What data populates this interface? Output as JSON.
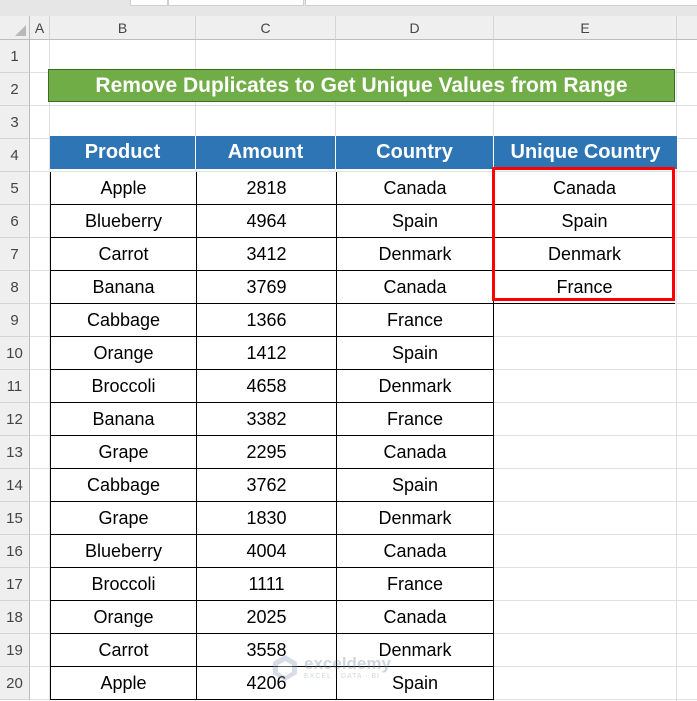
{
  "columns": [
    "A",
    "B",
    "C",
    "D",
    "E"
  ],
  "rows": [
    "1",
    "2",
    "3",
    "4",
    "5",
    "6",
    "7",
    "8",
    "9",
    "10",
    "11",
    "12",
    "13",
    "14",
    "15",
    "16",
    "17",
    "18",
    "19",
    "20"
  ],
  "title": "Remove Duplicates to Get Unique Values from Range",
  "headers": {
    "product": "Product",
    "amount": "Amount",
    "country": "Country",
    "unique_country": "Unique Country"
  },
  "table": [
    {
      "product": "Apple",
      "amount": "2818",
      "country": "Canada"
    },
    {
      "product": "Blueberry",
      "amount": "4964",
      "country": "Spain"
    },
    {
      "product": "Carrot",
      "amount": "3412",
      "country": "Denmark"
    },
    {
      "product": "Banana",
      "amount": "3769",
      "country": "Canada"
    },
    {
      "product": "Cabbage",
      "amount": "1366",
      "country": "France"
    },
    {
      "product": "Orange",
      "amount": "1412",
      "country": "Spain"
    },
    {
      "product": "Broccoli",
      "amount": "4658",
      "country": "Denmark"
    },
    {
      "product": "Banana",
      "amount": "3382",
      "country": "France"
    },
    {
      "product": "Grape",
      "amount": "2295",
      "country": "Canada"
    },
    {
      "product": "Cabbage",
      "amount": "3762",
      "country": "Spain"
    },
    {
      "product": "Grape",
      "amount": "1830",
      "country": "Denmark"
    },
    {
      "product": "Blueberry",
      "amount": "4004",
      "country": "Canada"
    },
    {
      "product": "Broccoli",
      "amount": "1111",
      "country": "France"
    },
    {
      "product": "Orange",
      "amount": "2025",
      "country": "Canada"
    },
    {
      "product": "Carrot",
      "amount": "3558",
      "country": "Denmark"
    },
    {
      "product": "Apple",
      "amount": "4206",
      "country": "Spain"
    }
  ],
  "unique_countries": [
    "Canada",
    "Spain",
    "Denmark",
    "France"
  ],
  "watermark": {
    "name": "exceldemy",
    "tagline": "EXCEL · DATA · BI"
  },
  "colors": {
    "title_bg": "#70ad47",
    "header_bg": "#2e75b6",
    "highlight_border": "#ff0000"
  }
}
